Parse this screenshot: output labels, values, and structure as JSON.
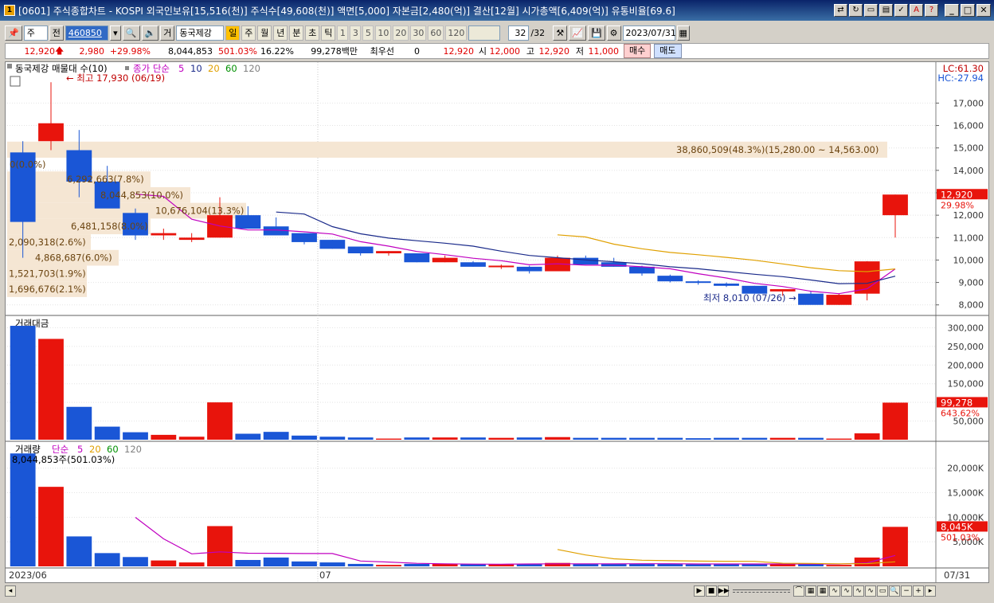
{
  "window": {
    "title": "[0601] 주식종합차트 - KOSPI 외국인보유[15,516(천)] 주식수[49,608(천)] 액면[5,000] 자본금[2,480(억)] 결산[12월] 시가총액[6,409(억)] 유통비율[69.6]",
    "app_icon": "1"
  },
  "toolbar": {
    "market": "주",
    "prev_label": "전",
    "code": "460850",
    "stock_type": "거",
    "stock_name": "동국제강",
    "periods": [
      "일",
      "주",
      "월",
      "년",
      "분",
      "초",
      "틱"
    ],
    "selected_period": "일",
    "nums": [
      "1",
      "3",
      "5",
      "10",
      "20",
      "30",
      "60",
      "120"
    ],
    "count": "32",
    "count_total": "/32",
    "date": "2023/07/31"
  },
  "info": {
    "price": "12,920",
    "change": "2,980",
    "change_pct": "+29.98%",
    "volume": "8,044,853",
    "volume_pct": "501.03%",
    "turnover": "16.22%",
    "amount": "99,278백만",
    "best_label": "최우선",
    "best_val": "0",
    "quote_price": "12,920",
    "open_label": "시",
    "open": "12,000",
    "high_label": "고",
    "high": "12,920",
    "low_label": "저",
    "low": "11,000",
    "buy_label": "매수",
    "sell_label": "매도"
  },
  "panels": {
    "price_legend": {
      "name": "동국제강 매물대 수(10)",
      "ma_label": "종가 단순",
      "periods": [
        "5",
        "10",
        "20",
        "60",
        "120"
      ]
    },
    "price_hi_label": "LC:61.30",
    "price_lo_label": "HC:-27.94",
    "max_note": "최고 17,930 (06/19)",
    "min_note": "최저 8,010 (07/26)",
    "current_price_tag": "12,920",
    "current_pct_tag": "29.98%",
    "price_axis": [
      "17,000",
      "16,000",
      "15,000",
      "14,000",
      "13,000",
      "12,000",
      "11,000",
      "10,000",
      "9,000",
      "8,000"
    ],
    "vol_profile": [
      "38,860,509(48.3%)(15,280.00 ~ 14,563.00)",
      "0(0.0%)",
      "6,292,663(7.8%)",
      "8,044,853(10.0%)",
      "10,676,104(13.3%)",
      "6,481,158(8.0%)",
      "2,090,318(2.6%)",
      "4,868,687(6.0%)",
      "1,521,703(1.9%)",
      "1,696,676(2.1%)"
    ],
    "amount_legend": "거래대금",
    "amount_axis": [
      "300,000",
      "250,000",
      "200,000",
      "150,000",
      "100,000",
      "50,000"
    ],
    "amount_tag": "99,278",
    "amount_pct_tag": "643.62%",
    "volume_legend": {
      "name": "거래량",
      "ma_label": "단순",
      "periods": [
        "5",
        "20",
        "60",
        "120"
      ]
    },
    "volume_note": "8,044,853주(501.03%)",
    "volume_axis": [
      "20,000K",
      "15,000K",
      "10,000K",
      "5,000K"
    ],
    "volume_tag": "8,045K",
    "volume_pct_tag": "501.03%",
    "x_labels": [
      "2023/06",
      "07",
      "07/31"
    ]
  },
  "chart_data": {
    "type": "candlestick",
    "candles": [
      {
        "o": 14800,
        "h": 15300,
        "l": 10100,
        "c": 11700
      },
      {
        "o": 15300,
        "h": 17930,
        "l": 14900,
        "c": 16100
      },
      {
        "o": 14900,
        "h": 15800,
        "l": 12800,
        "c": 13500
      },
      {
        "o": 13500,
        "h": 14200,
        "l": 12800,
        "c": 12300
      },
      {
        "o": 12100,
        "h": 12300,
        "l": 10900,
        "c": 11100
      },
      {
        "o": 11100,
        "h": 11400,
        "l": 10900,
        "c": 11200
      },
      {
        "o": 10900,
        "h": 11200,
        "l": 10800,
        "c": 11000
      },
      {
        "o": 11000,
        "h": 12800,
        "l": 11000,
        "c": 12000
      },
      {
        "o": 12000,
        "h": 12400,
        "l": 11400,
        "c": 11400
      },
      {
        "o": 11500,
        "h": 11900,
        "l": 11100,
        "c": 11100
      },
      {
        "o": 11200,
        "h": 11200,
        "l": 10700,
        "c": 10800
      },
      {
        "o": 10900,
        "h": 10900,
        "l": 10500,
        "c": 10500
      },
      {
        "o": 10600,
        "h": 10600,
        "l": 10200,
        "c": 10300
      },
      {
        "o": 10300,
        "h": 10400,
        "l": 10200,
        "c": 10400
      },
      {
        "o": 10300,
        "h": 10300,
        "l": 9900,
        "c": 9900
      },
      {
        "o": 9900,
        "h": 10200,
        "l": 9900,
        "c": 10100
      },
      {
        "o": 9900,
        "h": 9950,
        "l": 9700,
        "c": 9700
      },
      {
        "o": 9700,
        "h": 9800,
        "l": 9600,
        "c": 9750
      },
      {
        "o": 9700,
        "h": 9750,
        "l": 9400,
        "c": 9500
      },
      {
        "o": 9500,
        "h": 10200,
        "l": 9500,
        "c": 10100
      },
      {
        "o": 10100,
        "h": 10200,
        "l": 9800,
        "c": 9800
      },
      {
        "o": 9900,
        "h": 10100,
        "l": 9700,
        "c": 9700
      },
      {
        "o": 9700,
        "h": 9750,
        "l": 9300,
        "c": 9400
      },
      {
        "o": 9300,
        "h": 9350,
        "l": 9000,
        "c": 9050
      },
      {
        "o": 9050,
        "h": 9100,
        "l": 8900,
        "c": 9000
      },
      {
        "o": 8950,
        "h": 9000,
        "l": 8800,
        "c": 8850
      },
      {
        "o": 8850,
        "h": 8850,
        "l": 8500,
        "c": 8500
      },
      {
        "o": 8600,
        "h": 8700,
        "l": 8400,
        "c": 8700
      },
      {
        "o": 8500,
        "h": 8600,
        "l": 8010,
        "c": 8000
      },
      {
        "o": 8000,
        "h": 8500,
        "l": 8000,
        "c": 8450
      },
      {
        "o": 8500,
        "h": 9950,
        "l": 8200,
        "c": 9940
      },
      {
        "o": 12000,
        "h": 12920,
        "l": 11000,
        "c": 12920
      }
    ],
    "amount": [
      305000,
      270000,
      88000,
      35000,
      20000,
      13000,
      8000,
      100000,
      16000,
      21000,
      11000,
      8000,
      6000,
      3000,
      6000,
      6000,
      6000,
      5000,
      6000,
      7000,
      5000,
      5000,
      5000,
      5000,
      4000,
      5000,
      5000,
      5000,
      5000,
      3000,
      17000,
      99278
    ],
    "volume": [
      23000,
      16200,
      6100,
      2700,
      1900,
      1200,
      800,
      8200,
      1300,
      1800,
      1000,
      800,
      500,
      300,
      500,
      500,
      500,
      400,
      500,
      700,
      500,
      500,
      500,
      500,
      400,
      500,
      500,
      500,
      500,
      300,
      1800,
      8045
    ],
    "up_color": "#e8140c",
    "down_color": "#1a56d6"
  }
}
